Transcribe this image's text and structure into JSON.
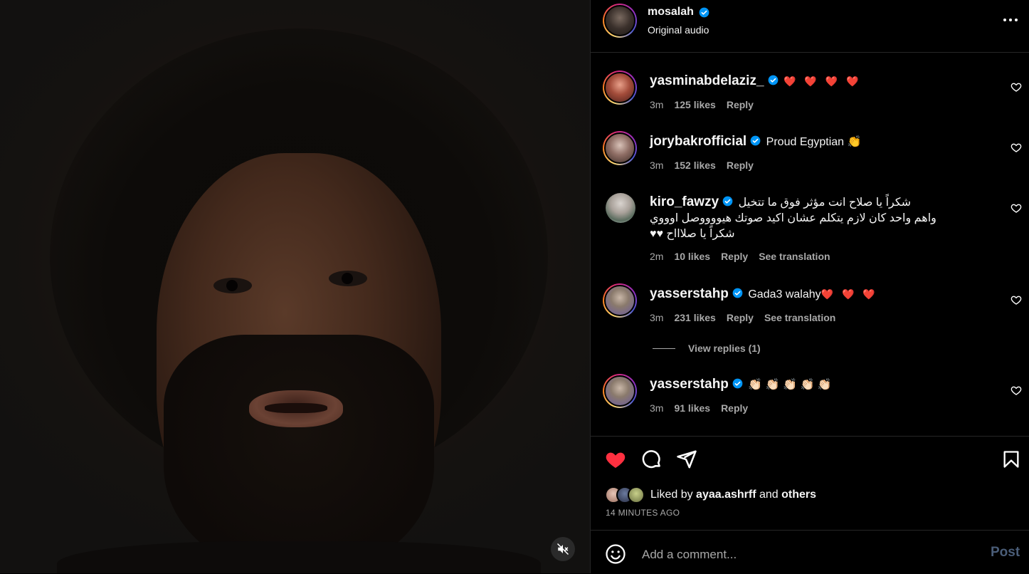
{
  "post": {
    "username": "mosalah",
    "audio": "Original audio",
    "more_label": "More options"
  },
  "comments": [
    {
      "username": "yasminabdelaziz_",
      "text": "❤️ ❤️ ❤️ ❤️",
      "time": "3m",
      "likes": "125 likes",
      "reply": "Reply",
      "translate": ""
    },
    {
      "username": "jorybakrofficial",
      "text": "Proud Egyptian 👏",
      "time": "3m",
      "likes": "152 likes",
      "reply": "Reply",
      "translate": ""
    },
    {
      "username": "kiro_fawzy",
      "text": "شكراً يا صلاح انت مؤثر فوق ما تتخيل",
      "text2": "واهم واحد كان لازم يتكلم عشان اكيد صوتك هيووووصل اوووي",
      "text3": "شكراً يا صلاااح ♥♥",
      "time": "2m",
      "likes": "10 likes",
      "reply": "Reply",
      "translate": "See translation"
    },
    {
      "username": "yasserstahp",
      "text": "Gada3 walahy",
      "text_hearts": "❤️ ❤️ ❤️",
      "time": "3m",
      "likes": "231 likes",
      "reply": "Reply",
      "translate": "See translation"
    },
    {
      "username": "yasserstahp",
      "text": "👏🏻 👏🏻 👏🏻 👏🏻 👏🏻",
      "time": "3m",
      "likes": "91 likes",
      "reply": "Reply",
      "translate": ""
    }
  ],
  "view_replies": "View replies (1)",
  "likes_summary": {
    "prefix": "Liked by",
    "user": "ayaa.ashrff",
    "and": "and",
    "others": "others"
  },
  "timestamp": "14 MINUTES AGO",
  "composer": {
    "placeholder": "Add a comment...",
    "post_label": "Post"
  },
  "colors": {
    "like_active": "#ff3040",
    "verified": "#0095f6",
    "post_disabled": "#4a5d78"
  },
  "icons": [
    "heart-icon",
    "comment-icon",
    "share-icon",
    "bookmark-icon",
    "emoji-icon",
    "mute-icon",
    "more-icon",
    "verified-badge-icon"
  ]
}
